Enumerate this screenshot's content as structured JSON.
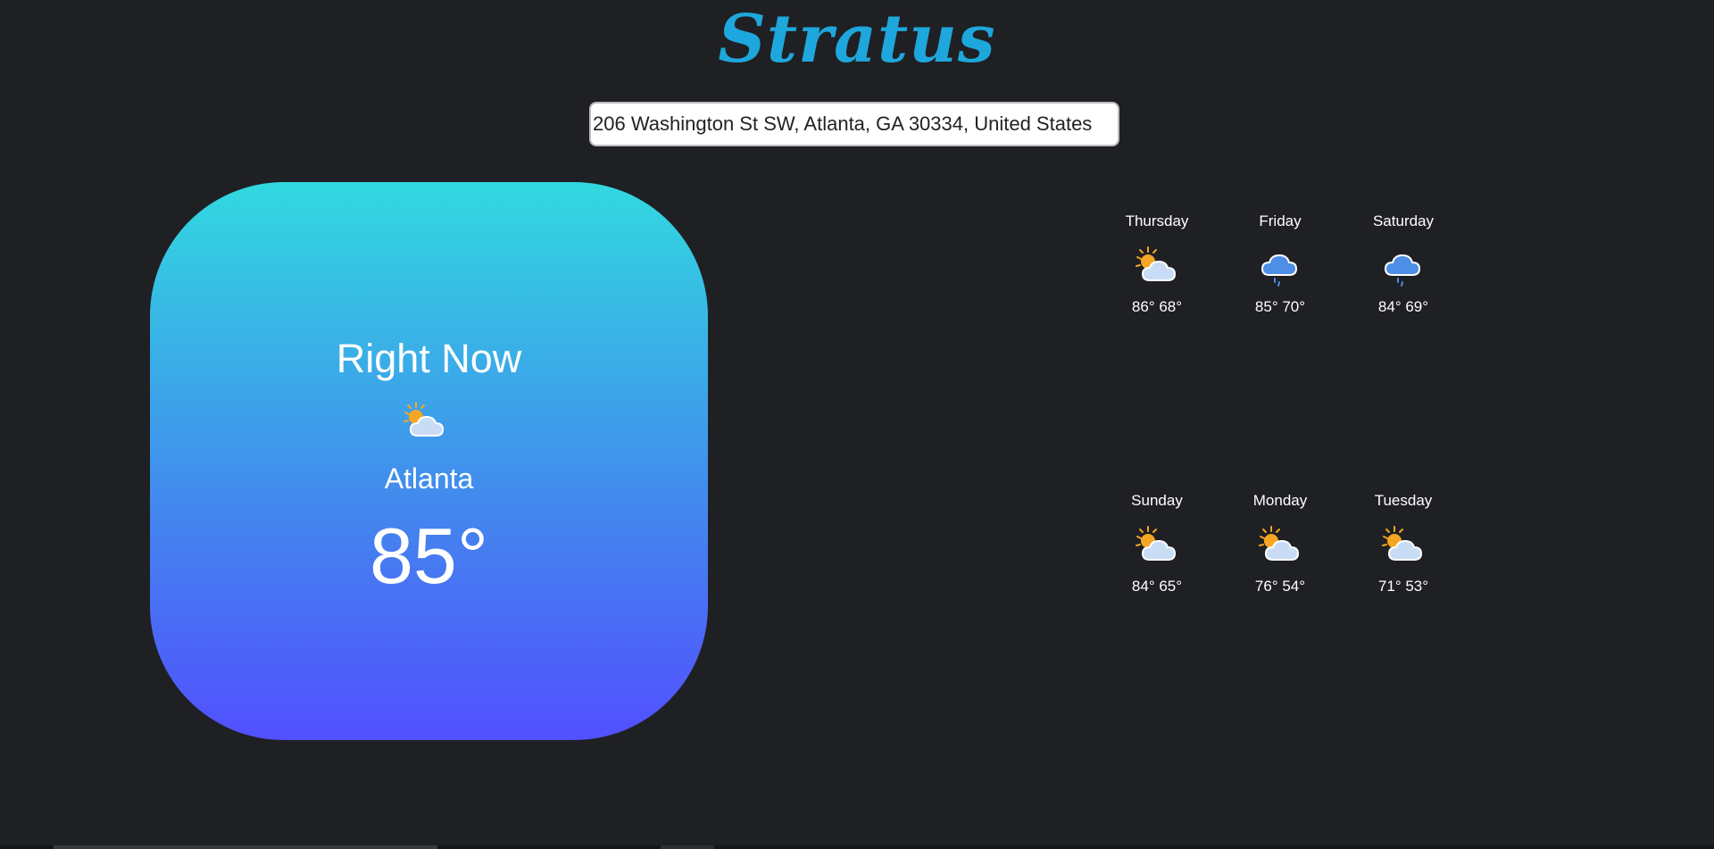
{
  "app": {
    "title": "Stratus"
  },
  "search": {
    "value": "206 Washington St SW, Atlanta, GA 30334, United States"
  },
  "current": {
    "heading": "Right Now",
    "icon": "partly-cloudy-icon",
    "city": "Atlanta",
    "temperature": "85°"
  },
  "forecast": [
    {
      "day": "Thursday",
      "icon": "partly-cloudy-icon",
      "temps": "86° 68°"
    },
    {
      "day": "Friday",
      "icon": "rain-cloud-icon",
      "temps": "85° 70°"
    },
    {
      "day": "Saturday",
      "icon": "rain-cloud-icon",
      "temps": "84° 69°"
    },
    {
      "day": "Sunday",
      "icon": "partly-cloudy-icon",
      "temps": "84° 65°"
    },
    {
      "day": "Monday",
      "icon": "partly-cloudy-icon",
      "temps": "76° 54°"
    },
    {
      "day": "Tuesday",
      "icon": "partly-cloudy-icon",
      "temps": "71° 53°"
    }
  ],
  "colors": {
    "background": "#1f2023",
    "brand": "#1ea7dc",
    "card_gradient_top": "#31d9e0",
    "card_gradient_bottom": "#5250ff",
    "sun": "#f5a623",
    "cloud_light": "#c9dcf5",
    "cloud_rain": "#4d8ee6"
  }
}
